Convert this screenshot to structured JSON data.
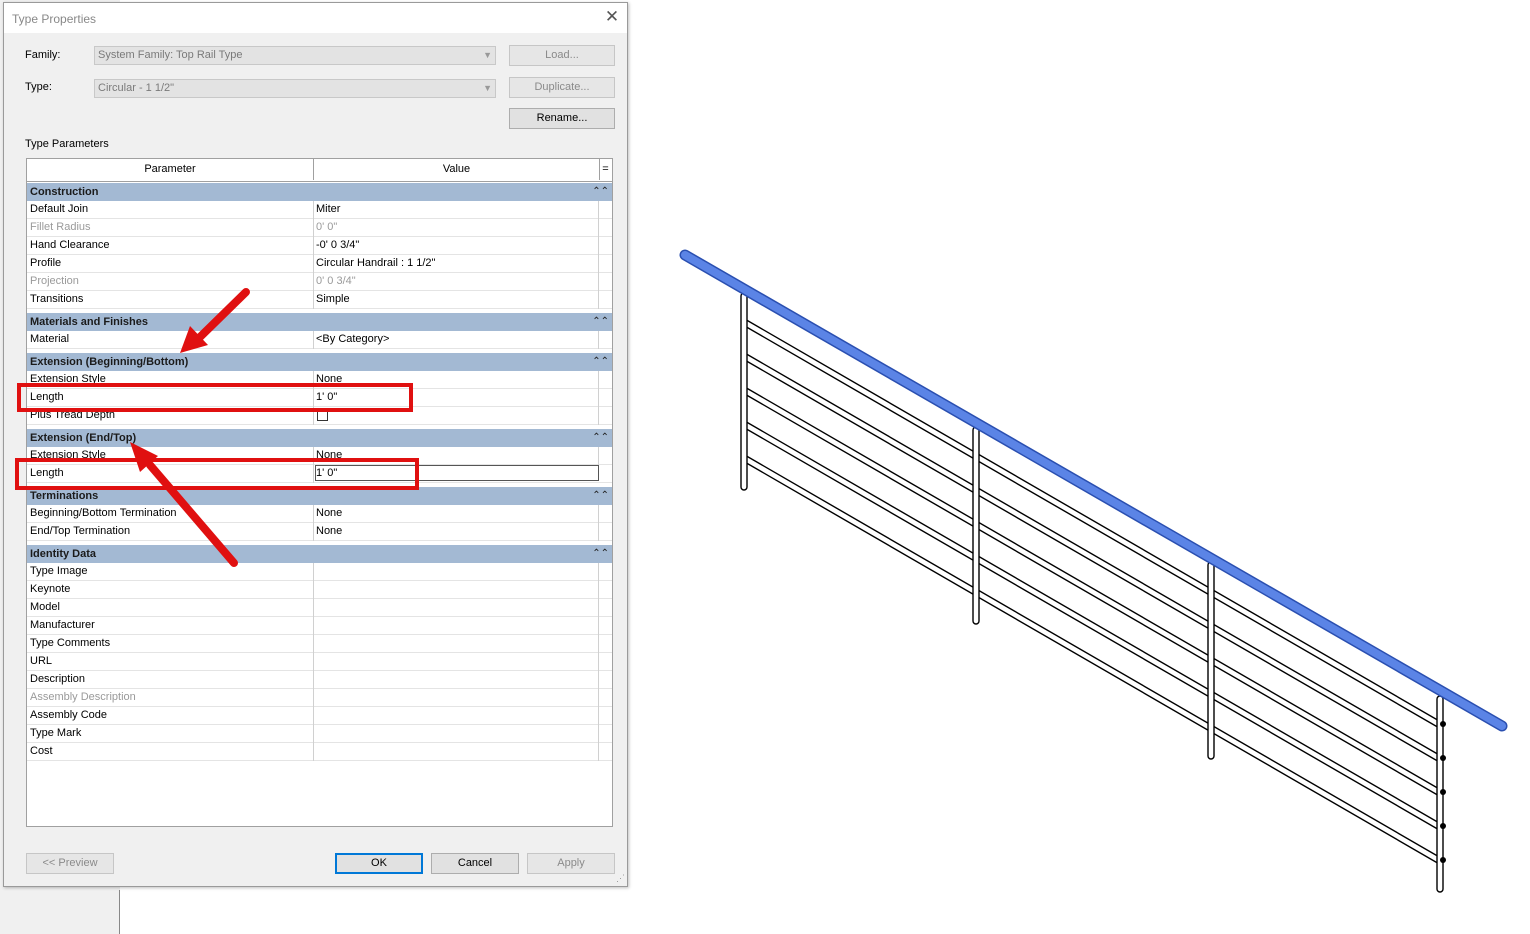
{
  "dialog": {
    "title": "Type Properties",
    "family_label": "Family:",
    "family_value": "System Family: Top Rail Type",
    "type_label": "Type:",
    "type_value": "Circular - 1 1/2\"",
    "load_button": "Load...",
    "duplicate_button": "Duplicate...",
    "rename_button": "Rename...",
    "type_parameters_label": "Type Parameters",
    "col_parameter": "Parameter",
    "col_value": "Value",
    "col_menu": "=",
    "groups": {
      "construction": "Construction",
      "materials": "Materials and Finishes",
      "ext_begin": "Extension (Beginning/Bottom)",
      "ext_end": "Extension (End/Top)",
      "terminations": "Terminations",
      "identity": "Identity Data"
    },
    "rows": {
      "default_join": {
        "name": "Default Join",
        "value": "Miter"
      },
      "fillet_radius": {
        "name": "Fillet Radius",
        "value": "0'  0\""
      },
      "hand_clearance": {
        "name": "Hand Clearance",
        "value": "-0'  0 3/4\""
      },
      "profile": {
        "name": "Profile",
        "value": "Circular Handrail : 1 1/2\""
      },
      "projection": {
        "name": "Projection",
        "value": "0'  0 3/4\""
      },
      "transitions": {
        "name": "Transitions",
        "value": "Simple"
      },
      "material": {
        "name": "Material",
        "value": "<By Category>"
      },
      "ext_style_begin": {
        "name": "Extension Style",
        "value": "None"
      },
      "length_begin": {
        "name": "Length",
        "value": "1'  0\""
      },
      "plus_tread": {
        "name": "Plus Tread Depth",
        "value": ""
      },
      "ext_style_end": {
        "name": "Extension Style",
        "value": "None"
      },
      "length_end": {
        "name": "Length",
        "value": "1'  0\""
      },
      "begin_termination": {
        "name": "Beginning/Bottom Termination",
        "value": "None"
      },
      "end_termination": {
        "name": "End/Top Termination",
        "value": "None"
      },
      "type_image": {
        "name": "Type Image",
        "value": ""
      },
      "keynote": {
        "name": "Keynote",
        "value": ""
      },
      "model": {
        "name": "Model",
        "value": ""
      },
      "manufacturer": {
        "name": "Manufacturer",
        "value": ""
      },
      "type_comments": {
        "name": "Type Comments",
        "value": ""
      },
      "url": {
        "name": "URL",
        "value": ""
      },
      "description": {
        "name": "Description",
        "value": ""
      },
      "assembly_description": {
        "name": "Assembly Description",
        "value": ""
      },
      "assembly_code": {
        "name": "Assembly Code",
        "value": ""
      },
      "type_mark": {
        "name": "Type Mark",
        "value": ""
      },
      "cost": {
        "name": "Cost",
        "value": ""
      }
    },
    "preview_button": "<< Preview",
    "ok_button": "OK",
    "cancel_button": "Cancel",
    "apply_button": "Apply"
  },
  "colors": {
    "group_header": "#a3b9d3",
    "annotation_red": "#e01010",
    "top_rail_blue": "#4a73d8"
  }
}
